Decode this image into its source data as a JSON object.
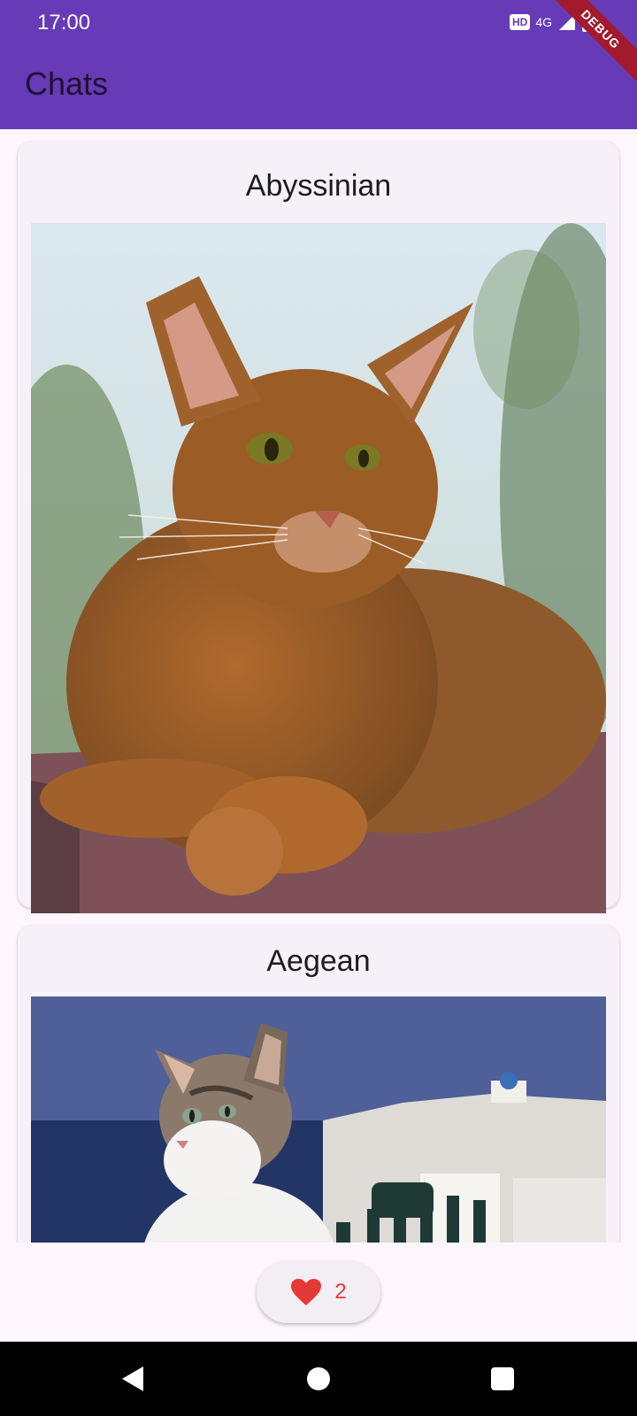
{
  "status_bar": {
    "time": "17:00",
    "hd_badge": "HD",
    "network": "4G",
    "debug_banner": "DEBUG"
  },
  "app_bar": {
    "title": "Chats"
  },
  "cards": [
    {
      "title": "Abyssinian"
    },
    {
      "title": "Aegean"
    }
  ],
  "fab": {
    "count": "2",
    "icon": "heart-icon",
    "color": "#e53935"
  },
  "theme": {
    "primary": "#673ab7",
    "background": "#fdf7fd",
    "card_background": "#f6f1f8"
  },
  "nav_bar": {
    "buttons": [
      "back-icon",
      "home-icon",
      "recents-icon"
    ]
  }
}
